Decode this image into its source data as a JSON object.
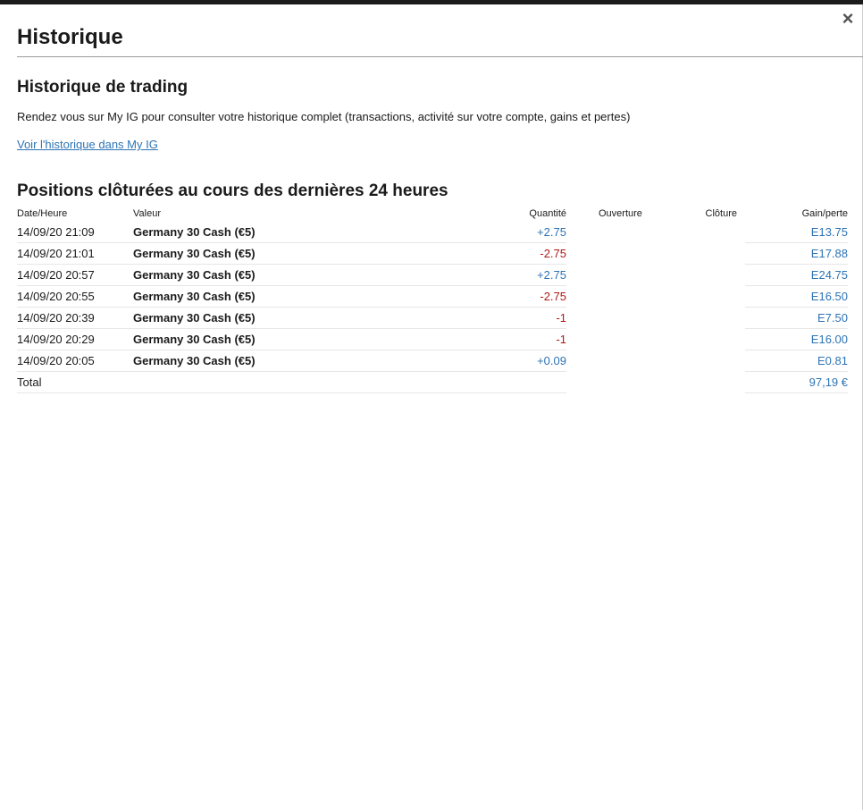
{
  "window": {
    "title": "Historique",
    "close_icon": "×"
  },
  "trading": {
    "heading": "Historique de trading",
    "description": "Rendez vous sur My IG pour consulter votre historique complet (transactions, activité sur votre compte, gains et pertes)",
    "link_label": "Voir l'historique dans My IG"
  },
  "closed_positions": {
    "heading": "Positions clôturées au cours des dernières 24 heures",
    "columns": [
      "Date/Heure",
      "Valeur",
      "Quantité",
      "Ouverture",
      "Clôture",
      "Gain/perte"
    ],
    "rows": [
      {
        "datetime": "14/09/20 21:09",
        "market": "Germany 30 Cash (€5)",
        "quantity": "+2.75",
        "direction": "buy",
        "pl": "E13.75"
      },
      {
        "datetime": "14/09/20 21:01",
        "market": "Germany 30 Cash (€5)",
        "quantity": "-2.75",
        "direction": "sell",
        "pl": "E17.88"
      },
      {
        "datetime": "14/09/20 20:57",
        "market": "Germany 30 Cash (€5)",
        "quantity": "+2.75",
        "direction": "buy",
        "pl": "E24.75"
      },
      {
        "datetime": "14/09/20 20:55",
        "market": "Germany 30 Cash (€5)",
        "quantity": "-2.75",
        "direction": "sell",
        "pl": "E16.50"
      },
      {
        "datetime": "14/09/20 20:39",
        "market": "Germany 30 Cash (€5)",
        "quantity": "-1",
        "direction": "sell",
        "pl": "E7.50"
      },
      {
        "datetime": "14/09/20 20:29",
        "market": "Germany 30 Cash (€5)",
        "quantity": "-1",
        "direction": "sell",
        "pl": "E16.00"
      },
      {
        "datetime": "14/09/20 20:05",
        "market": "Germany 30 Cash (€5)",
        "quantity": "+0.09",
        "direction": "buy",
        "pl": "E0.81"
      }
    ],
    "total_label": "Total",
    "total_value": "97,19 €"
  },
  "colors": {
    "accent_blue": "#2e74b5",
    "negative_red": "#b01818",
    "text": "#1a1a1a"
  }
}
